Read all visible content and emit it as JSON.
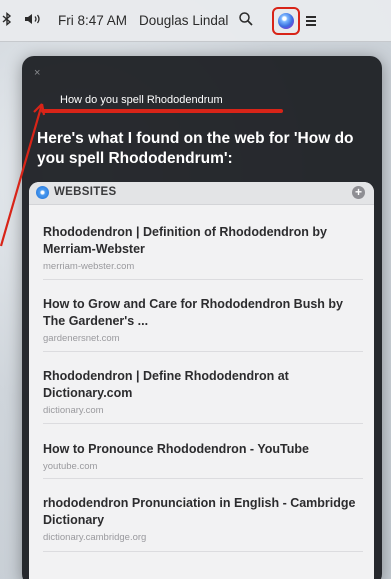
{
  "menubar": {
    "clock": "Fri 8:47 AM",
    "user": "Douglas Lindal"
  },
  "siri": {
    "close_label": "×",
    "query": "How do you spell Rhododendrum",
    "answer": "Here's what I found on the web for 'How do you spell Rhododendrum':",
    "section_label": "WEBSITES",
    "more_label": "+",
    "results": [
      {
        "title": "Rhododendron | Definition of Rhododendron by Merriam-Webster",
        "url": "merriam-webster.com"
      },
      {
        "title": "How to Grow and Care for Rhododendron Bush by The Gardener's ...",
        "url": "gardenersnet.com"
      },
      {
        "title": "Rhododendron | Define Rhododendron at Dictionary.com",
        "url": "dictionary.com"
      },
      {
        "title": "How to Pronounce Rhododendron - YouTube",
        "url": "youtube.com"
      },
      {
        "title": "rhododendron Pronunciation in English - Cambridge Dictionary",
        "url": "dictionary.cambridge.org"
      }
    ]
  },
  "colors": {
    "annotation_red": "#d82418",
    "panel_bg": "#181a1e",
    "card_bg": "#f2f2f3"
  }
}
